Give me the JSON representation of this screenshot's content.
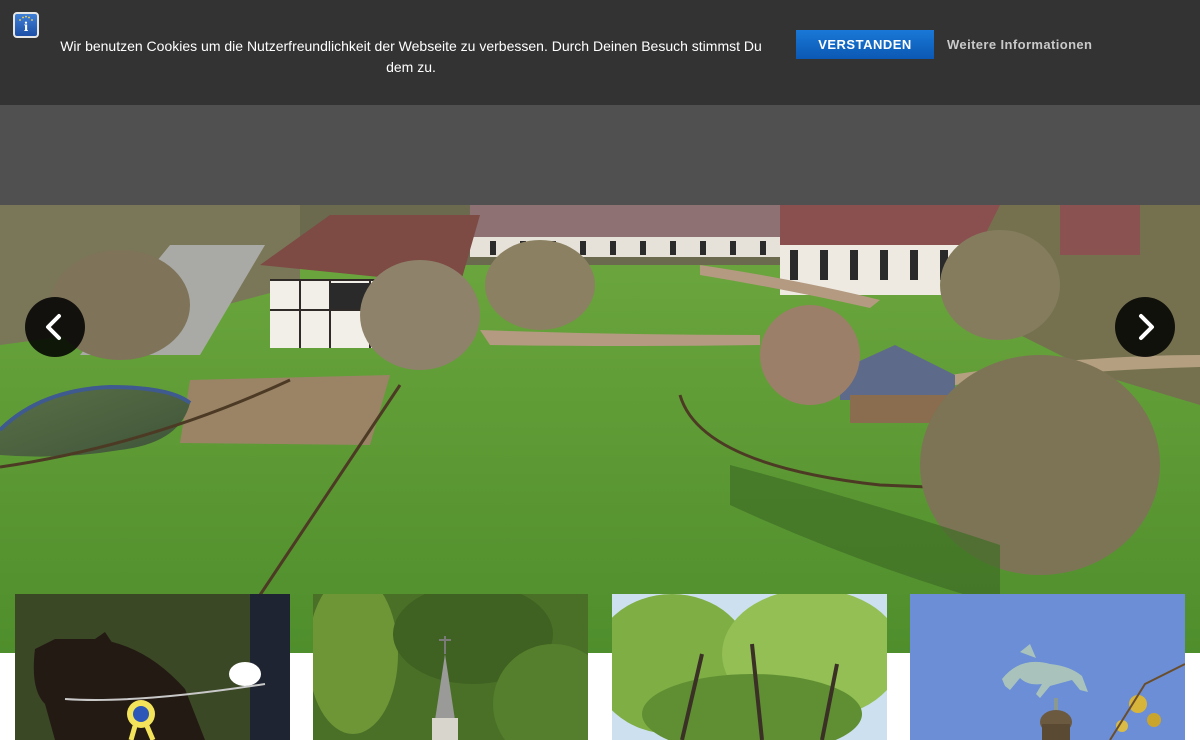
{
  "cookie_bar": {
    "message": "Wir benutzen Cookies um die Nutzerfreundlichkeit der Webseite zu verbessen. Durch Deinen Besuch stimmst Du dem zu.",
    "accept_label": "VERSTANDEN",
    "more_info_label": "Weitere Informationen",
    "info_icon": "info-icon",
    "accent_color": "#0b68c7"
  },
  "header": {
    "background_color": "#505050"
  },
  "slider": {
    "prev_icon": "chevron-left-icon",
    "next_icon": "chevron-right-icon",
    "slide_subject": "aerial view of horse stud farm with half-timbered stables and green paddocks"
  },
  "tiles": [
    {
      "subject": "dressage horse with rosette ribbon"
    },
    {
      "subject": "church tower spire among trees"
    },
    {
      "subject": "green trees in park"
    },
    {
      "subject": "horse statue against blue sky"
    }
  ]
}
